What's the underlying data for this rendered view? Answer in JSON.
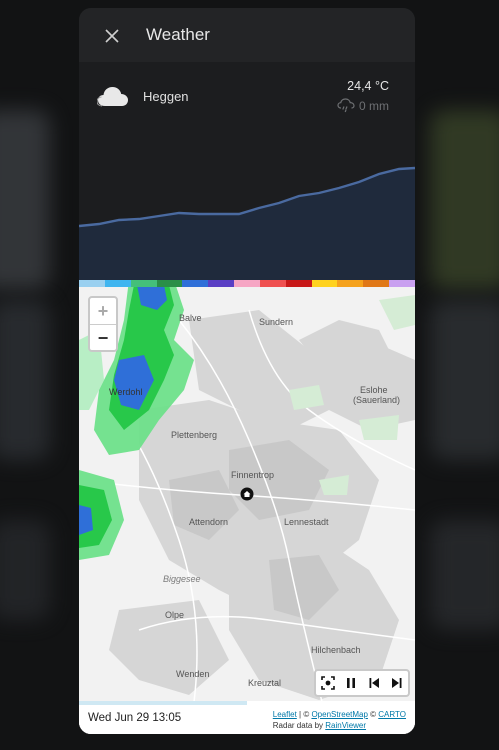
{
  "dialog": {
    "title": "Weather",
    "close_icon": "close-icon"
  },
  "weather": {
    "location": "Heggen",
    "temperature": "24,4 °C",
    "precipitation": "0 mm",
    "condition_icon": "cloud-icon",
    "precip_icon": "rain-cloud-icon"
  },
  "radar": {
    "colorbar": [
      "#9ad0f0",
      "#3fb5f0",
      "#44c07a",
      "#2a8f48",
      "#2f6fd8",
      "#5a3fc4",
      "#f6a6c4",
      "#ef5050",
      "#c81818",
      "#ffd21f",
      "#f5a21d",
      "#e07818",
      "#c9a0f0"
    ],
    "zoom_in": "+",
    "zoom_out": "−",
    "places": {
      "balve": "Balve",
      "sundern": "Sundern",
      "werdohl": "Werdohl",
      "eslohe": "Eslohe",
      "eslohe2": "(Sauerland)",
      "plettenberg": "Plettenberg",
      "finnentrop": "Finnentrop",
      "attendorn": "Attendorn",
      "lennestadt": "Lennestadt",
      "biggesee": "Biggesee",
      "olpe": "Olpe",
      "hilchenbach": "Hilchenbach",
      "wenden": "Wenden",
      "kreuztal": "Kreuztal"
    },
    "controls": [
      "recenter-icon",
      "pause-icon",
      "skip-back-icon",
      "skip-forward-icon"
    ],
    "timestamp": "Wed Jun 29 13:05",
    "progress": 0.5,
    "attribution": {
      "leaflet": "Leaflet",
      "sep1": " | © ",
      "osm": "OpenStreetMap",
      "sep2": " © ",
      "carto": "CARTO",
      "radar_prefix": "Radar data by ",
      "rainviewer": "RainViewer"
    }
  }
}
